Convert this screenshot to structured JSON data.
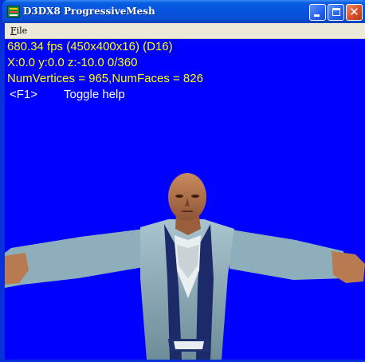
{
  "window": {
    "title": "D3DX8 ProgressiveMesh",
    "icons": {
      "app": "directx-app-icon",
      "minimize": "minimize-icon",
      "maximize": "maximize-icon",
      "close": "close-icon"
    },
    "close_glyph": "✕"
  },
  "menu": {
    "file_first": "F",
    "file_rest": "ile"
  },
  "hud": {
    "fps": "680.34 fps (450x400x16) (D16)",
    "position": "X:0.0 y:0.0 z:-10.0 0/360",
    "counts": "NumVertices = 965,NumFaces = 826",
    "help_key": "<F1>",
    "help_text": "Toggle help"
  },
  "colors": {
    "background": "#0000fe",
    "stats_text": "#ffff00",
    "help_text": "#ffffff"
  }
}
